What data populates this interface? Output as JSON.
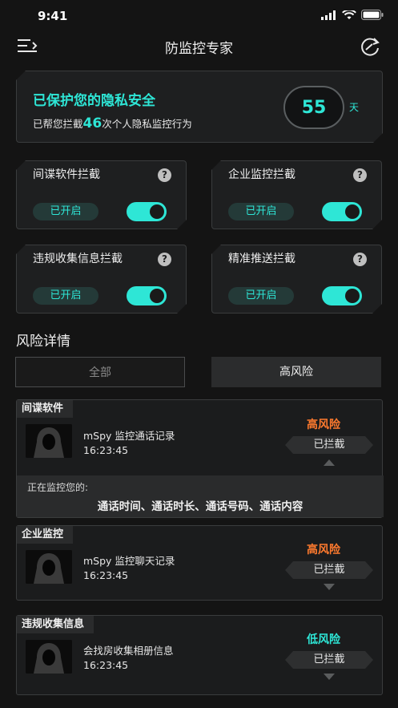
{
  "status": {
    "time": "9:41"
  },
  "nav": {
    "title": "防监控专家"
  },
  "protect": {
    "title": "已保护您的隐私安全",
    "sub_prefix": "已帮您拦截",
    "blocked_count": "46",
    "sub_suffix": "次个人隐私监控行为",
    "days": "55",
    "days_unit": "天"
  },
  "cards": [
    {
      "title": "间谍软件拦截",
      "status": "已开启",
      "help": "?"
    },
    {
      "title": "企业监控拦截",
      "status": "已开启",
      "help": "?"
    },
    {
      "title": "违规收集信息拦截",
      "status": "已开启",
      "help": "?"
    },
    {
      "title": "精准推送拦截",
      "status": "已开启",
      "help": "?"
    }
  ],
  "section": {
    "title": "风险详情"
  },
  "tabs": {
    "all": "全部",
    "high": "高风险"
  },
  "risks": [
    {
      "label": "间谍软件",
      "name": "mSpy 监控通话记录",
      "time": "16:23:45",
      "level": "高风险",
      "level_color": "#ff7a2e",
      "action": "已拦截",
      "monitor_head": "正在监控您的:",
      "monitor_items": "通话时间、通话时长、通话号码、通话内容"
    },
    {
      "label": "企业监控",
      "name": "mSpy 监控聊天记录",
      "time": "16:23:45",
      "level": "高风险",
      "level_color": "#ff7a2e",
      "action": "已拦截"
    },
    {
      "label": "违规收集信息",
      "name": "会找房收集相册信息",
      "time": "16:23:45",
      "level": "低风险",
      "level_color": "#2ee6d6",
      "action": "已拦截"
    }
  ],
  "colors": {
    "accent": "#2ee6d6",
    "high_risk": "#ff7a2e",
    "background": "#141414"
  }
}
